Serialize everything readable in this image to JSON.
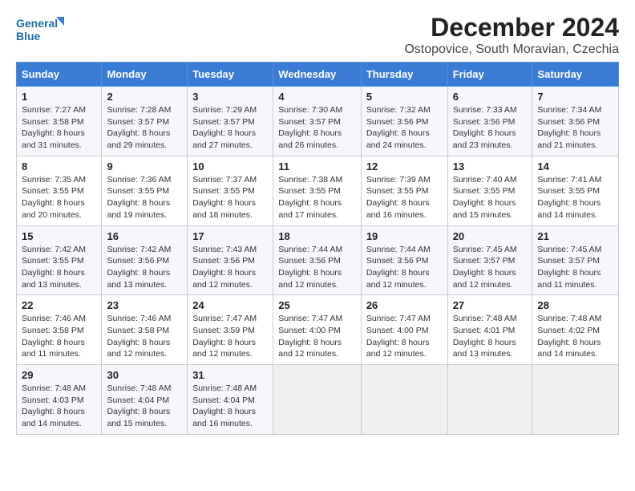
{
  "logo": {
    "line1": "General",
    "line2": "Blue"
  },
  "title": "December 2024",
  "subtitle": "Ostopovice, South Moravian, Czechia",
  "days_of_week": [
    "Sunday",
    "Monday",
    "Tuesday",
    "Wednesday",
    "Thursday",
    "Friday",
    "Saturday"
  ],
  "weeks": [
    [
      {
        "day": "1",
        "sunrise": "7:27 AM",
        "sunset": "3:58 PM",
        "daylight": "8 hours and 31 minutes."
      },
      {
        "day": "2",
        "sunrise": "7:28 AM",
        "sunset": "3:57 PM",
        "daylight": "8 hours and 29 minutes."
      },
      {
        "day": "3",
        "sunrise": "7:29 AM",
        "sunset": "3:57 PM",
        "daylight": "8 hours and 27 minutes."
      },
      {
        "day": "4",
        "sunrise": "7:30 AM",
        "sunset": "3:57 PM",
        "daylight": "8 hours and 26 minutes."
      },
      {
        "day": "5",
        "sunrise": "7:32 AM",
        "sunset": "3:56 PM",
        "daylight": "8 hours and 24 minutes."
      },
      {
        "day": "6",
        "sunrise": "7:33 AM",
        "sunset": "3:56 PM",
        "daylight": "8 hours and 23 minutes."
      },
      {
        "day": "7",
        "sunrise": "7:34 AM",
        "sunset": "3:56 PM",
        "daylight": "8 hours and 21 minutes."
      }
    ],
    [
      {
        "day": "8",
        "sunrise": "7:35 AM",
        "sunset": "3:55 PM",
        "daylight": "8 hours and 20 minutes."
      },
      {
        "day": "9",
        "sunrise": "7:36 AM",
        "sunset": "3:55 PM",
        "daylight": "8 hours and 19 minutes."
      },
      {
        "day": "10",
        "sunrise": "7:37 AM",
        "sunset": "3:55 PM",
        "daylight": "8 hours and 18 minutes."
      },
      {
        "day": "11",
        "sunrise": "7:38 AM",
        "sunset": "3:55 PM",
        "daylight": "8 hours and 17 minutes."
      },
      {
        "day": "12",
        "sunrise": "7:39 AM",
        "sunset": "3:55 PM",
        "daylight": "8 hours and 16 minutes."
      },
      {
        "day": "13",
        "sunrise": "7:40 AM",
        "sunset": "3:55 PM",
        "daylight": "8 hours and 15 minutes."
      },
      {
        "day": "14",
        "sunrise": "7:41 AM",
        "sunset": "3:55 PM",
        "daylight": "8 hours and 14 minutes."
      }
    ],
    [
      {
        "day": "15",
        "sunrise": "7:42 AM",
        "sunset": "3:55 PM",
        "daylight": "8 hours and 13 minutes."
      },
      {
        "day": "16",
        "sunrise": "7:42 AM",
        "sunset": "3:56 PM",
        "daylight": "8 hours and 13 minutes."
      },
      {
        "day": "17",
        "sunrise": "7:43 AM",
        "sunset": "3:56 PM",
        "daylight": "8 hours and 12 minutes."
      },
      {
        "day": "18",
        "sunrise": "7:44 AM",
        "sunset": "3:56 PM",
        "daylight": "8 hours and 12 minutes."
      },
      {
        "day": "19",
        "sunrise": "7:44 AM",
        "sunset": "3:56 PM",
        "daylight": "8 hours and 12 minutes."
      },
      {
        "day": "20",
        "sunrise": "7:45 AM",
        "sunset": "3:57 PM",
        "daylight": "8 hours and 12 minutes."
      },
      {
        "day": "21",
        "sunrise": "7:45 AM",
        "sunset": "3:57 PM",
        "daylight": "8 hours and 11 minutes."
      }
    ],
    [
      {
        "day": "22",
        "sunrise": "7:46 AM",
        "sunset": "3:58 PM",
        "daylight": "8 hours and 11 minutes."
      },
      {
        "day": "23",
        "sunrise": "7:46 AM",
        "sunset": "3:58 PM",
        "daylight": "8 hours and 12 minutes."
      },
      {
        "day": "24",
        "sunrise": "7:47 AM",
        "sunset": "3:59 PM",
        "daylight": "8 hours and 12 minutes."
      },
      {
        "day": "25",
        "sunrise": "7:47 AM",
        "sunset": "4:00 PM",
        "daylight": "8 hours and 12 minutes."
      },
      {
        "day": "26",
        "sunrise": "7:47 AM",
        "sunset": "4:00 PM",
        "daylight": "8 hours and 12 minutes."
      },
      {
        "day": "27",
        "sunrise": "7:48 AM",
        "sunset": "4:01 PM",
        "daylight": "8 hours and 13 minutes."
      },
      {
        "day": "28",
        "sunrise": "7:48 AM",
        "sunset": "4:02 PM",
        "daylight": "8 hours and 14 minutes."
      }
    ],
    [
      {
        "day": "29",
        "sunrise": "7:48 AM",
        "sunset": "4:03 PM",
        "daylight": "8 hours and 14 minutes."
      },
      {
        "day": "30",
        "sunrise": "7:48 AM",
        "sunset": "4:04 PM",
        "daylight": "8 hours and 15 minutes."
      },
      {
        "day": "31",
        "sunrise": "7:48 AM",
        "sunset": "4:04 PM",
        "daylight": "8 hours and 16 minutes."
      },
      null,
      null,
      null,
      null
    ]
  ]
}
